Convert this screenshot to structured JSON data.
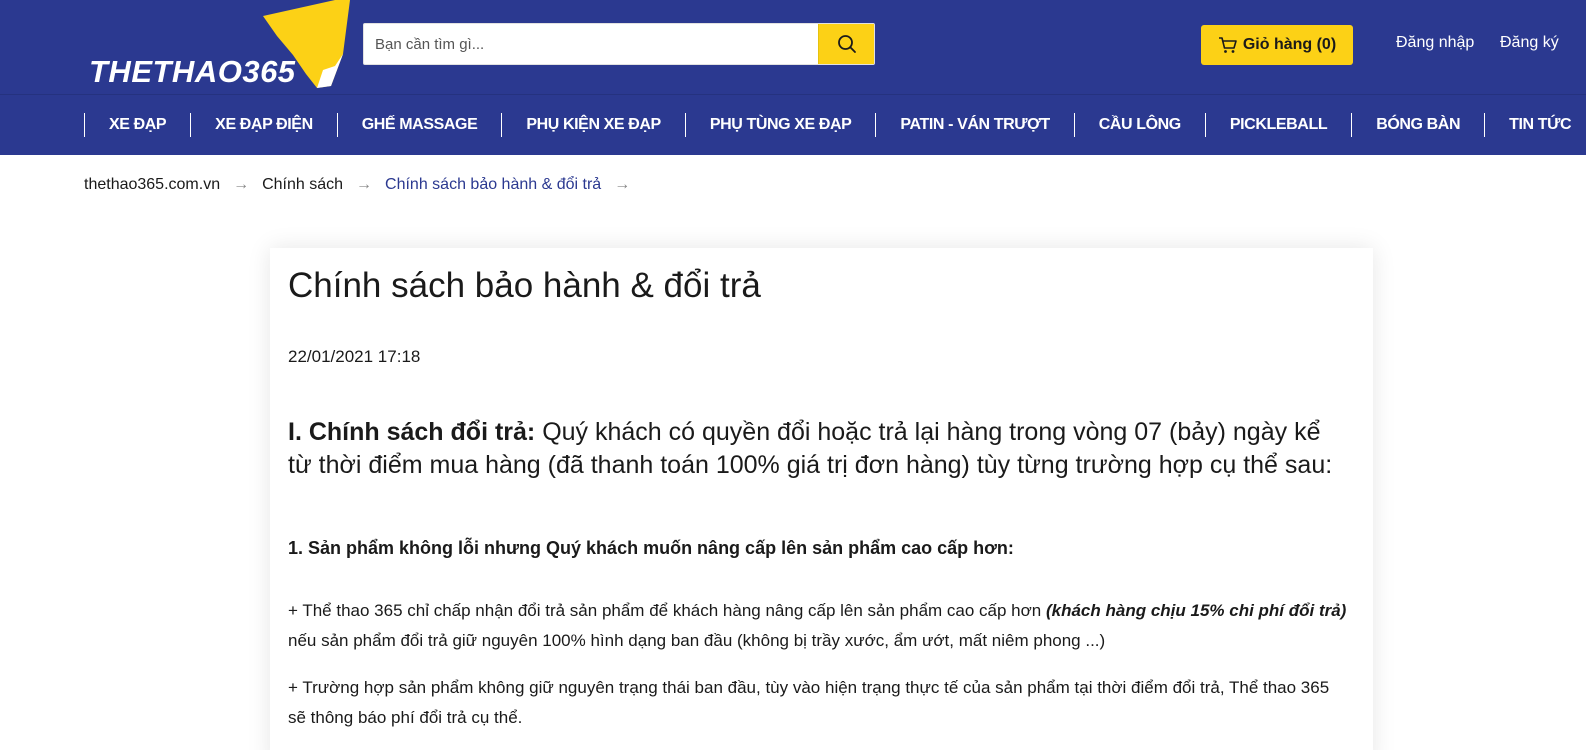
{
  "header": {
    "logo_text": "THETHAO365",
    "search_placeholder": "Bạn cần tìm gì...",
    "cart_label": "Giỏ hàng (0)",
    "login_label": "Đăng nhập",
    "register_label": "Đăng ký",
    "brand_color": "#2b3990",
    "accent_color": "#fcd116"
  },
  "nav": {
    "items": [
      {
        "label": "XE ĐẠP"
      },
      {
        "label": "XE ĐẠP ĐIỆN"
      },
      {
        "label": "GHẾ MASSAGE"
      },
      {
        "label": "PHỤ KIỆN XE ĐẠP"
      },
      {
        "label": "PHỤ TÙNG XE ĐẠP"
      },
      {
        "label": "PATIN - VÁN TRƯỢT"
      },
      {
        "label": "CẦU LÔNG"
      },
      {
        "label": "PICKLEBALL"
      },
      {
        "label": "BÓNG BÀN"
      },
      {
        "label": "TIN TỨC"
      }
    ]
  },
  "breadcrumb": {
    "items": [
      {
        "label": "thethao365.com.vn"
      },
      {
        "label": "Chính sách"
      },
      {
        "label": "Chính sách bảo hành & đổi trả"
      }
    ],
    "separator": "→"
  },
  "article": {
    "title": "Chính sách bảo hành & đổi trả",
    "date": "22/01/2021 17:18",
    "intro_bold": " I. Chính sách đổi trả:",
    "intro_text": " Quý khách có quyền đổi hoặc trả lại hàng trong vòng 07 (bảy) ngày kể từ thời điểm mua hàng (đã thanh toán 100% giá trị đơn hàng) tùy từng trường hợp cụ thể sau:",
    "section1_heading": "1. Sản phẩm không lỗi nhưng Quý khách muốn nâng cấp lên sản phẩm cao cấp hơn:",
    "para1_start": "+ Thể thao 365 chỉ chấp nhận đổi trả sản phẩm để khách hàng nâng cấp lên sản phẩm cao cấp hơn ",
    "para1_emphasis": "(khách hàng chịu 15% chi phí đổi trả)",
    "para1_end": " nếu sản phẩm đổi trả giữ nguyên 100% hình dạng ban đầu (không bị trầy xước, ẩm ướt, mất niêm phong ...)",
    "para2": "+ Trường hợp sản phẩm không giữ nguyên trạng thái ban đầu, tùy vào hiện trạng thực tế của sản phẩm tại thời điểm đổi trả, Thể thao 365 sẽ thông báo phí đổi trả cụ thể."
  }
}
